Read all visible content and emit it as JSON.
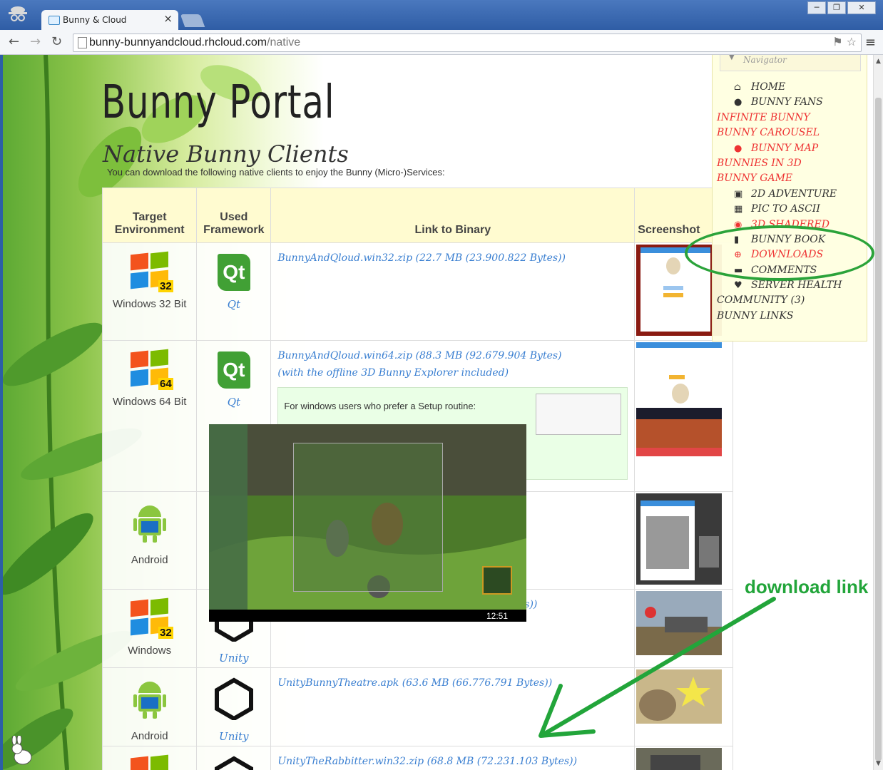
{
  "browser": {
    "tab_title": "Bunny & Cloud",
    "url_host": "bunny-bunnyandcloud.rhcloud.com",
    "url_path": "/native",
    "window_buttons": [
      "─",
      "❐",
      "✕"
    ]
  },
  "page": {
    "portal_title": "Bunny  Portal",
    "heading": "Native Bunny Clients",
    "intro": "You can download the following native clients to enjoy the Bunny (Micro-)Services:",
    "columns": {
      "target_line1": "Target",
      "target_line2": "Environment",
      "framework_line1": "Used",
      "framework_line2": "Framework",
      "link": "Link to Binary",
      "screenshot": "Screenshot"
    },
    "rows": [
      {
        "env": "Windows 32 Bit",
        "badge": "32",
        "framework": "Qt",
        "link": "BunnyAndQloud.win32.zip (22.7 MB (23.900.822 Bytes))"
      },
      {
        "env": "Windows 64 Bit",
        "badge": "64",
        "framework": "Qt",
        "link": "BunnyAndQloud.win64.zip (88.3 MB (92.679.904 Bytes)",
        "note": "(with the offline 3D Bunny Explorer included)",
        "setup_text": "For windows users who prefer a Setup routine:"
      },
      {
        "env": "Android",
        "framework": "",
        "link": ""
      },
      {
        "env": "Windows",
        "badge": "32",
        "framework": "Unity",
        "link": "tes))"
      },
      {
        "env": "Android",
        "framework": "Unity",
        "link": "UnityBunnyTheatre.apk (63.6 MB (66.776.791 Bytes))"
      },
      {
        "env": "",
        "framework": "",
        "link": "UnityTheRabbitter.win32.zip (68.8 MB (72.231.103 Bytes))"
      }
    ]
  },
  "navigator": {
    "title": "Navigator",
    "items": [
      {
        "label": "HOME",
        "icon": "home-icon",
        "color": "dark"
      },
      {
        "label": "BUNNY FANS",
        "icon": "user-icon",
        "color": "dark"
      },
      {
        "label": "INFINITE BUNNY",
        "icon": "",
        "color": "red"
      },
      {
        "label": "BUNNY CAROUSEL",
        "icon": "",
        "color": "red"
      },
      {
        "label": "BUNNY MAP",
        "icon": "map-marker-icon",
        "color": "red"
      },
      {
        "label": "BUNNIES IN 3D",
        "icon": "",
        "color": "red"
      },
      {
        "label": "BUNNY GAME",
        "icon": "",
        "color": "red"
      },
      {
        "label": "2D ADVENTURE",
        "icon": "image-icon",
        "color": "dark"
      },
      {
        "label": "PIC TO ASCII",
        "icon": "qr-code-icon",
        "color": "dark"
      },
      {
        "label": "3D SHADERED",
        "icon": "camera-icon",
        "color": "red"
      },
      {
        "label": "BUNNY BOOK",
        "icon": "book-icon",
        "color": "dark"
      },
      {
        "label": "DOWNLOADS",
        "icon": "download-icon",
        "color": "red"
      },
      {
        "label": "COMMENTS",
        "icon": "comment-icon",
        "color": "dark"
      },
      {
        "label": "SERVER HEALTH",
        "icon": "heart-icon",
        "color": "dark"
      },
      {
        "label": "COMMUNITY (3)",
        "icon": "",
        "color": "dark"
      },
      {
        "label": "BUNNY LINKS",
        "icon": "",
        "color": "dark"
      }
    ]
  },
  "overlay": {
    "time": "12:51"
  },
  "annotation": {
    "label": "download link",
    "color": "#22a53a"
  }
}
